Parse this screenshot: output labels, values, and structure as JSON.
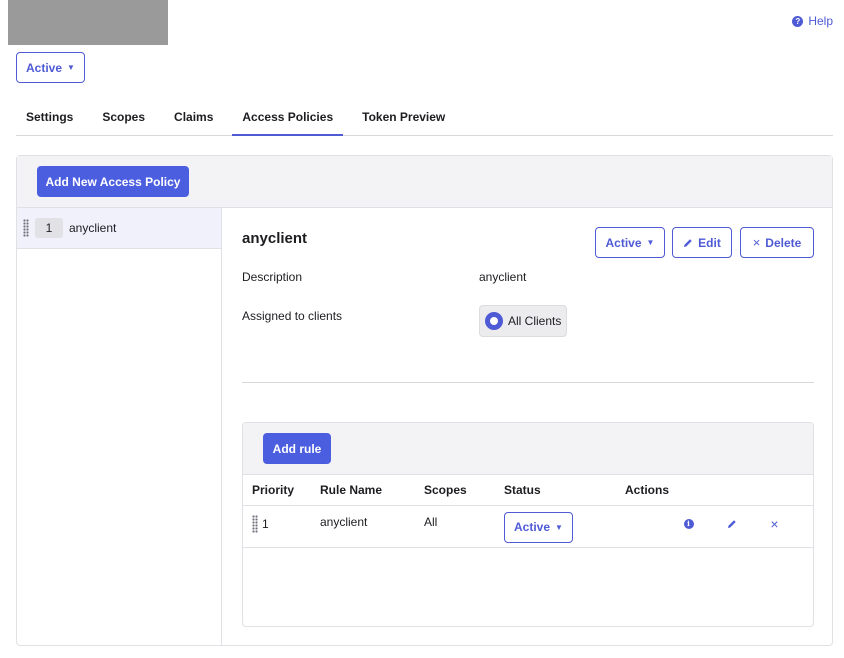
{
  "header": {
    "help_label": "Help",
    "help_icon": "question-circle-icon"
  },
  "app": {
    "status_label": "Active"
  },
  "tabs": [
    {
      "label": "Settings"
    },
    {
      "label": "Scopes"
    },
    {
      "label": "Claims"
    },
    {
      "label": "Access Policies",
      "active": true
    },
    {
      "label": "Token Preview"
    }
  ],
  "policies": {
    "add_button_label": "Add New Access Policy",
    "items": [
      {
        "priority": "1",
        "name": "anyclient"
      }
    ]
  },
  "detail": {
    "title": "anyclient",
    "status_label": "Active",
    "edit_label": "Edit",
    "delete_label": "Delete",
    "description_label": "Description",
    "description_value": "anyclient",
    "assigned_label": "Assigned to clients",
    "assigned_value": "All Clients"
  },
  "rules": {
    "add_button_label": "Add rule",
    "columns": [
      "Priority",
      "Rule Name",
      "Scopes",
      "Status",
      "Actions"
    ],
    "rows": [
      {
        "priority": "1",
        "name": "anyclient",
        "scopes": "All",
        "status": "Active"
      }
    ]
  },
  "colors": {
    "accent": "#4f5bd5",
    "primary_button": "#4c5ee0"
  }
}
